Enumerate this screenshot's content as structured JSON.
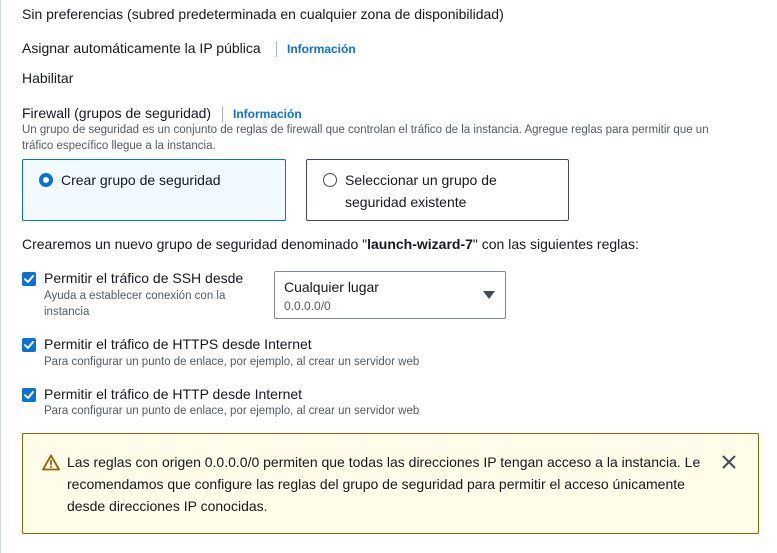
{
  "subnet": {
    "value": "Sin preferencias (subred predeterminada en cualquier zona de disponibilidad)"
  },
  "public_ip": {
    "label": "Asignar automáticamente la IP pública",
    "info_link": "Información",
    "value": "Habilitar"
  },
  "firewall": {
    "label": "Firewall (grupos de seguridad)",
    "info_link": "Información",
    "description_line1": "Un grupo de seguridad es un conjunto de reglas de firewall que controlan el tráfico de la instancia. Agregue reglas para permitir que un",
    "description_line2": "tráfico específico llegue a la instancia.",
    "options": [
      {
        "label": "Crear grupo de seguridad",
        "selected": true
      },
      {
        "label_line1": "Seleccionar un grupo de",
        "label_line2": "seguridad existente",
        "selected": false
      }
    ]
  },
  "new_group": {
    "prefix": "Crearemos un nuevo grupo de seguridad denominado \"",
    "name": "launch-wizard-7",
    "suffix": "\" con las siguientes reglas:"
  },
  "rules": {
    "ssh": {
      "label": "Permitir el tráfico de SSH desde",
      "help_line1": "Ayuda a establecer conexión con la",
      "help_line2": "instancia",
      "checked": true,
      "source_select": {
        "value": "Cualquier lugar",
        "sub": "0.0.0.0/0"
      }
    },
    "https": {
      "label": "Permitir el tráfico de HTTPS desde Internet",
      "help": "Para configurar un punto de enlace, por ejemplo, al crear un servidor web",
      "checked": true
    },
    "http": {
      "label": "Permitir el tráfico de HTTP desde Internet",
      "help": "Para configurar un punto de enlace, por ejemplo, al crear un servidor web",
      "checked": true
    }
  },
  "warning": {
    "line1": "Las reglas con origen 0.0.0.0/0 permiten que todas las direcciones IP tengan acceso a la instancia. Le",
    "line2": "recomendamos que configure las reglas del grupo de seguridad para permitir el acceso únicamente",
    "line3": "desde direcciones IP conocidas.",
    "icon": "warning-icon",
    "dismiss_icon": "close-icon"
  },
  "colors": {
    "accent": "#0972d3",
    "warning_bg": "#fffce9",
    "warning_border": "#8d6605"
  }
}
